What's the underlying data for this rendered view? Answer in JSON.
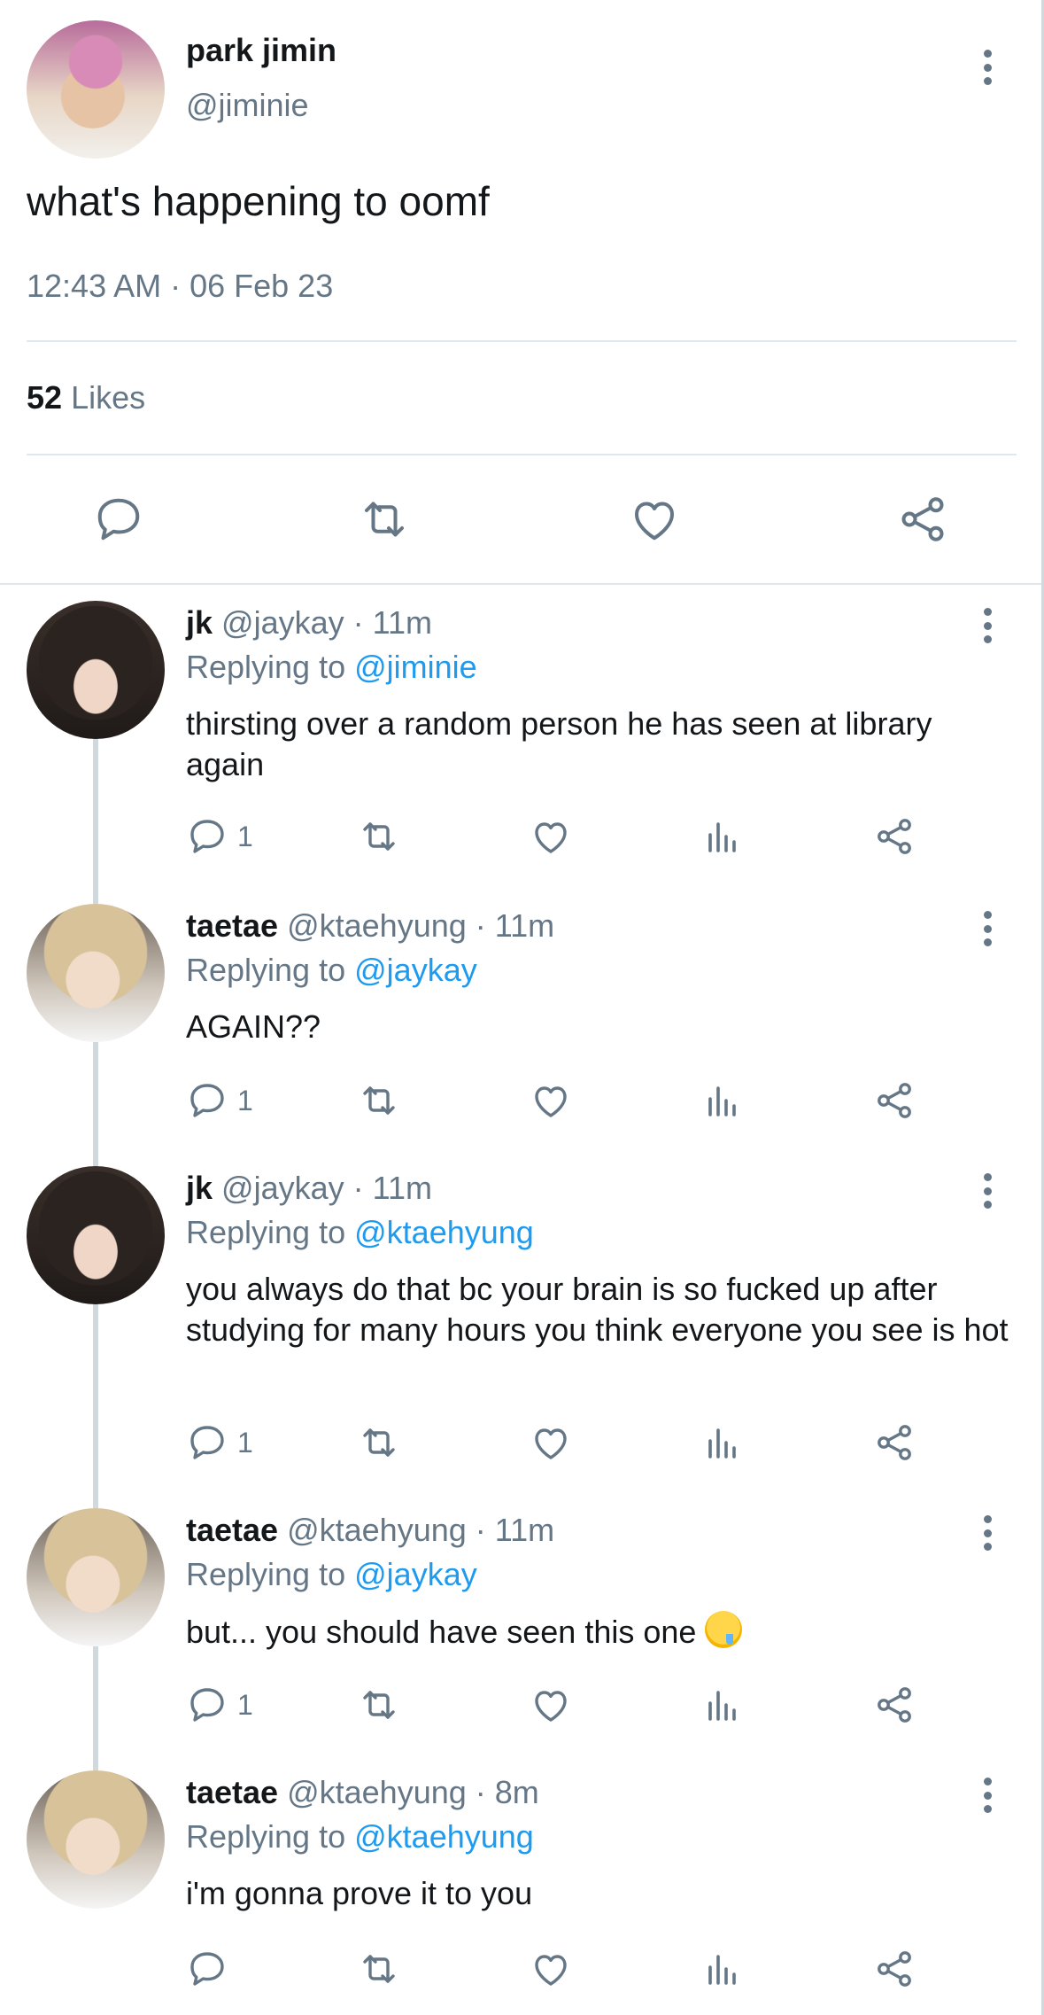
{
  "tweet": {
    "name": "park jimin",
    "handle": "@jiminie",
    "text": "what's happening to oomf",
    "timestamp": "12:43 AM · 06 Feb 23",
    "likes_count": "52",
    "likes_label": "Likes"
  },
  "replies": [
    {
      "name": "jk",
      "meta": "@jaykay · 11m",
      "replying_label": "Replying to",
      "mention": "@jiminie",
      "text": "thirsting over a random person he has seen at library again",
      "reply_count": "1"
    },
    {
      "name": "taetae",
      "meta": "@ktaehyung · 11m",
      "replying_label": "Replying to",
      "mention": "@jaykay",
      "text": "AGAIN??",
      "reply_count": "1"
    },
    {
      "name": "jk",
      "meta": "@jaykay · 11m",
      "replying_label": "Replying to",
      "mention": "@ktaehyung",
      "text": "you always do that bc your brain is so fucked up after studying for many hours you think everyone you see is hot",
      "reply_count": "1"
    },
    {
      "name": "taetae",
      "meta": "@ktaehyung · 11m",
      "replying_label": "Replying to",
      "mention": "@jaykay",
      "text": "but... you should have seen this one",
      "emoji": "drooling-face-emoji",
      "reply_count": "1"
    },
    {
      "name": "taetae",
      "meta": "@ktaehyung · 8m",
      "replying_label": "Replying to",
      "mention": "@ktaehyung",
      "text": "i'm gonna prove it to you",
      "reply_count": ""
    }
  ],
  "colors": {
    "text": "#14171a",
    "muted": "#657786",
    "link": "#1d9bf0",
    "divider": "#e1e8ed"
  },
  "icons": [
    "comment-icon",
    "retweet-icon",
    "like-icon",
    "share-icon",
    "views-icon",
    "more-options-icon"
  ]
}
